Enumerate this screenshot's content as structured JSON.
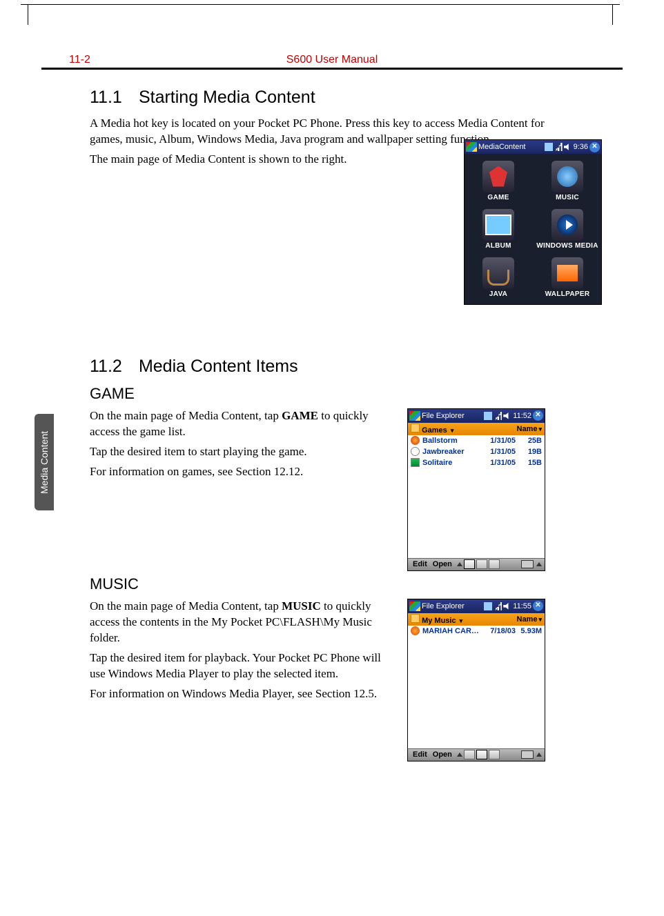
{
  "header": {
    "page_number": "11-2",
    "doc_title": "S600 User Manual"
  },
  "sidebar_tab": "Media Content",
  "section1": {
    "number": "11.1",
    "title": "Starting Media Content",
    "p1": "A Media hot key is located on your Pocket PC Phone. Press this key to access Media Content for games, music, Album, Windows Media, Java program and wallpaper setting function.",
    "p2": "The main page of Media Content is shown to the right."
  },
  "mediacontent_screen": {
    "app_title": "MediaContent",
    "time": "9:36",
    "items": [
      "GAME",
      "MUSIC",
      "ALBUM",
      "WINDOWS MEDIA",
      "JAVA",
      "WALLPAPER"
    ]
  },
  "section2": {
    "number": "11.2",
    "title": "Media Content Items"
  },
  "game": {
    "heading": "GAME",
    "p1a": "On the main page of Media Content, tap ",
    "p1b": "GAME",
    "p1c": " to quickly access the game list.",
    "p2": "Tap the desired item to start playing the game.",
    "p3": "For information on games, see Section 12.12.",
    "screen": {
      "app_title": "File Explorer",
      "time": "11:52",
      "folder": "Games",
      "sort": "Name",
      "rows": [
        {
          "name": "Ballstorm",
          "date": "1/31/05",
          "size": "25B"
        },
        {
          "name": "Jawbreaker",
          "date": "1/31/05",
          "size": "19B"
        },
        {
          "name": "Solitaire",
          "date": "1/31/05",
          "size": "15B"
        }
      ],
      "menu_edit": "Edit",
      "menu_open": "Open"
    }
  },
  "music": {
    "heading": "MUSIC",
    "p1a": "On the main page of Media Content, tap ",
    "p1b": "MUSIC",
    "p1c": " to quickly access the contents in the My Pocket PC\\FLASH\\My Music folder.",
    "p2": "Tap the desired item for playback. Your Pocket PC Phone will use Windows Media Player to play the selected item.",
    "p3": "For information on Windows Media Player, see Section 12.5.",
    "screen": {
      "app_title": "File Explorer",
      "time": "11:55",
      "folder": "My Music",
      "sort": "Name",
      "rows": [
        {
          "name": "MARIAH CARE...",
          "date": "7/18/03",
          "size": "5.93M"
        }
      ],
      "menu_edit": "Edit",
      "menu_open": "Open"
    }
  }
}
